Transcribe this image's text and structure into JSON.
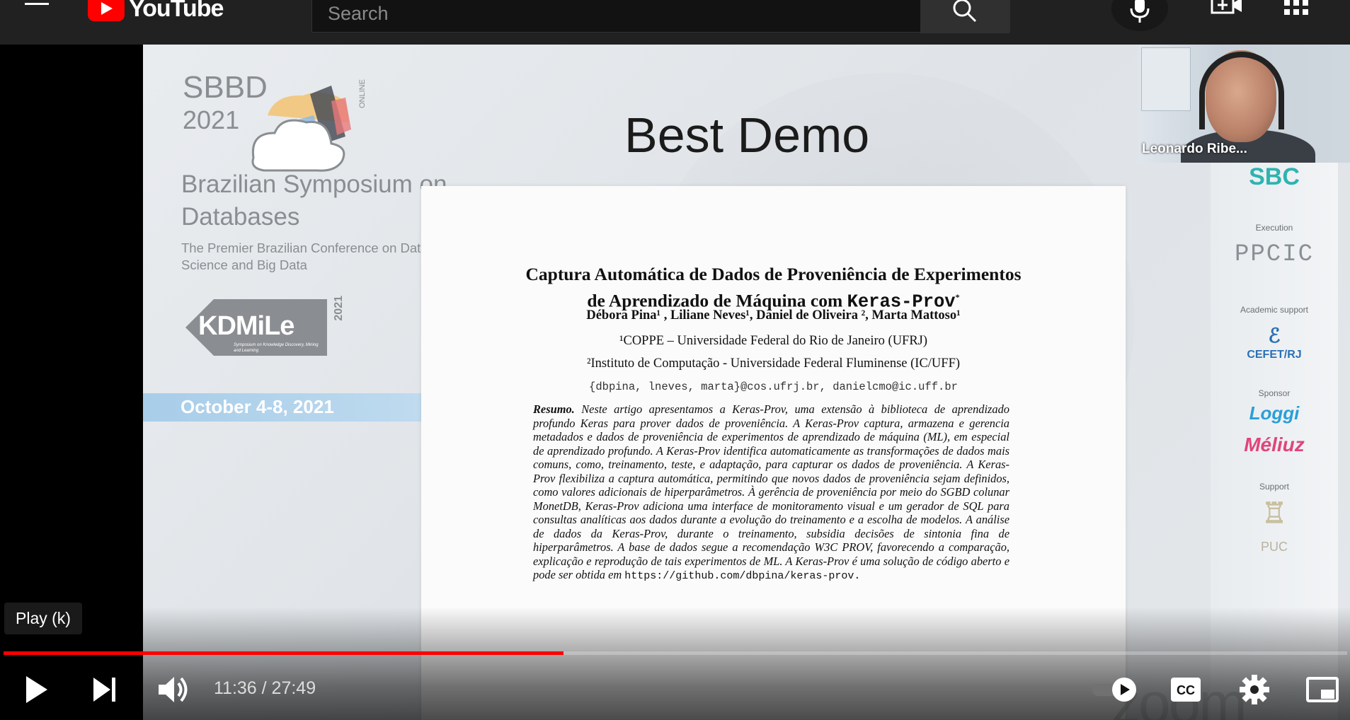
{
  "topbar": {
    "logo_text": "YouTube",
    "search_placeholder": "Search",
    "icons": [
      "menu-icon",
      "search-icon",
      "mic-icon",
      "create-video-icon",
      "apps-grid-icon"
    ]
  },
  "slide": {
    "sbbd_name": "SBBD",
    "sbbd_year": "2021",
    "online_tag": "ONLINE",
    "conf_title": "Brazilian Symposium on Databases",
    "conf_sub": "The Premier Brazilian Conference on Data Science and Big Data",
    "kdmile_name": "KDMiLe",
    "kdmile_year": "2021",
    "kdmile_sub": "Symposium on Knowledge Discovery, Mining and Learning",
    "dates": "October 4-8, 2021",
    "heading": "Best Demo",
    "paper": {
      "title_line1": "Captura Automática de Dados de Proveniência de Experimentos",
      "title_line2_prefix": "de Aprendizado de Máquina com ",
      "title_line2_code": "Keras-Prov",
      "title_line2_mark": "*",
      "authors": "Débora Pina¹ , Liliane Neves¹, Daniel de Oliveira ², Marta Mattoso¹",
      "affiliation1": "¹COPPE – Universidade Federal do Rio de Janeiro (UFRJ)",
      "affiliation2": "²Instituto de Computação - Universidade Federal Fluminense (IC/UFF)",
      "emails": "{dbpina, lneves, marta}@cos.ufrj.br, danielcmo@ic.uff.br",
      "abstract_head": "Resumo.",
      "abstract_body": "Neste artigo apresentamos a Keras-Prov, uma extensão à biblioteca de aprendizado profundo Keras para prover dados de proveniência. A Keras-Prov captura, armazena e gerencia metadados e dados de proveniência de experimentos de aprendizado de máquina (ML), em especial de aprendizado profundo. A Keras-Prov identifica automaticamente as transformações de dados mais comuns, como, treinamento, teste, e adaptação, para capturar os dados de proveniência. A Keras-Prov flexibiliza a captura automática, permitindo que novos dados de proveniência sejam definidos, como valores adicionais de hiperparâmetros. À gerência de proveniência por meio do SGBD colunar MonetDB, Keras-Prov adiciona uma interface de monitoramento visual e um gerador de SQL para consultas analíticas aos dados durante a evolução do treinamento e a escolha de modelos. A análise de dados da Keras-Prov, durante o treinamento, subsidia decisões de sintonia fina de hiperparâmetros. A base de dados segue a recomendação W3C PROV, favorecendo a comparação, explicação e reprodução de tais experimentos de ML. A Keras-Prov é uma solução de código aberto e pode ser obtida em",
      "abstract_url": "https://github.com/dbpina/keras-prov."
    },
    "sponsors": {
      "execution_label": "Execution",
      "academic_label": "Academic support",
      "sponsor_label": "Sponsor",
      "support_label": "Support",
      "sbc": "SBC",
      "ppcic": "PPCIC",
      "cefet": "CEFET/RJ",
      "loggi": "Loggi",
      "meliuz": "Méliuz",
      "puc": "PUC"
    }
  },
  "camera": {
    "participant_name": "Leonardo Ribe..."
  },
  "watermark": "zoom",
  "player": {
    "tooltip": "Play (k)",
    "current_time": "11:36",
    "duration": "27:49",
    "time_display": "11:36 / 27:49",
    "progress_fraction": 0.4168,
    "accent_color": "#ff0000",
    "autoplay_on": true,
    "cc_label": "CC"
  }
}
